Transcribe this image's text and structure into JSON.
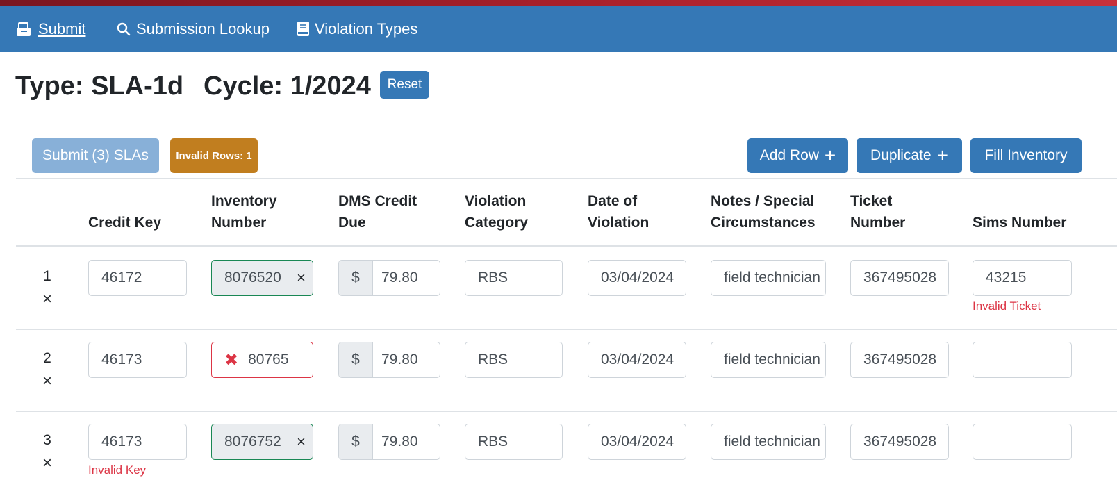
{
  "nav": {
    "submit": "Submit",
    "lookup": "Submission Lookup",
    "violation_types": "Violation Types"
  },
  "header": {
    "type": "Type: SLA-1d",
    "cycle": "Cycle: 1/2024",
    "reset": "Reset"
  },
  "toolbar": {
    "submit": "Submit (3) SLAs",
    "invalid_rows": "Invalid Rows: 1",
    "add_row": "Add Row",
    "duplicate": "Duplicate",
    "fill_inventory": "Fill Inventory"
  },
  "table": {
    "headers": [
      {
        "line1": "",
        "line2": "Credit Key"
      },
      {
        "line1": "Inventory",
        "line2": "Number"
      },
      {
        "line1": "DMS Credit",
        "line2": "Due"
      },
      {
        "line1": "Violation",
        "line2": "Category"
      },
      {
        "line1": "Date of",
        "line2": "Violation"
      },
      {
        "line1": "Notes / Special",
        "line2": "Circumstances"
      },
      {
        "line1": "Ticket",
        "line2": "Number"
      },
      {
        "line1": "",
        "line2": "Sims Number"
      }
    ],
    "currency_symbol": "$",
    "rows": [
      {
        "num": "1",
        "delete": "×",
        "credit_key": "46172",
        "credit_key_error": "",
        "inventory": "8076520",
        "inventory_state": "valid",
        "dms_credit": "79.80",
        "category": "RBS",
        "date": "03/04/2024",
        "notes": "field technician",
        "ticket": "367495028",
        "sims": "43215",
        "sims_error": "Invalid Ticket"
      },
      {
        "num": "2",
        "delete": "×",
        "credit_key": "46173",
        "credit_key_error": "",
        "inventory": "80765",
        "inventory_state": "invalid",
        "dms_credit": "79.80",
        "category": "RBS",
        "date": "03/04/2024",
        "notes": "field technician",
        "ticket": "367495028",
        "sims": "",
        "sims_error": ""
      },
      {
        "num": "3",
        "delete": "×",
        "credit_key": "46173",
        "credit_key_error": "Invalid Key",
        "inventory": "8076752",
        "inventory_state": "valid",
        "dms_credit": "79.80",
        "category": "RBS",
        "date": "03/04/2024",
        "notes": "field technician",
        "ticket": "367495028",
        "sims": "",
        "sims_error": ""
      }
    ]
  },
  "colors": {
    "navbar": "#3578b6",
    "primary": "#3578b6",
    "submit_disabled": "#88b0d8",
    "warning_badge": "#c17e1f",
    "valid": "#198754",
    "invalid": "#dc3545"
  }
}
